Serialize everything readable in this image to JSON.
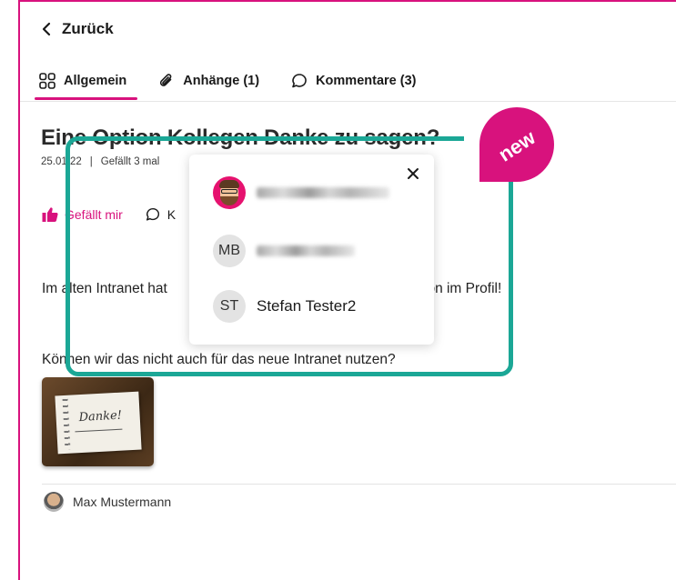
{
  "nav": {
    "back_label": "Zurück"
  },
  "tabs": [
    {
      "label": "Allgemein",
      "icon": "grid-icon",
      "active": true
    },
    {
      "label": "Anhänge (1)",
      "icon": "paperclip-icon",
      "active": false
    },
    {
      "label": "Kommentare (3)",
      "icon": "comment-icon",
      "active": false
    }
  ],
  "post": {
    "title": "Eine Option Kollegen Danke zu sagen?",
    "date": "25.01.22",
    "separator": "|",
    "likes_text": "Gefällt 3 mal",
    "like_label": "Gefällt mir",
    "comment_label_partial": "K",
    "paragraph1_start": "Im alten Intranet hat",
    "paragraph1_end": "ion im Profil!",
    "paragraph2": "Können wir das nicht auch für das neue Intranet nutzen?",
    "attachment_text": "Danke!",
    "author": "Max Mustermann"
  },
  "likes_popup": {
    "users": [
      {
        "avatar": "emoji",
        "name": ""
      },
      {
        "avatar": "initials",
        "initials": "MB",
        "name": ""
      },
      {
        "avatar": "initials",
        "initials": "ST",
        "name": "Stefan Tester2"
      }
    ]
  },
  "badge": {
    "label": "new"
  },
  "colors": {
    "accent": "#d8127d",
    "highlight": "#1ba796"
  }
}
